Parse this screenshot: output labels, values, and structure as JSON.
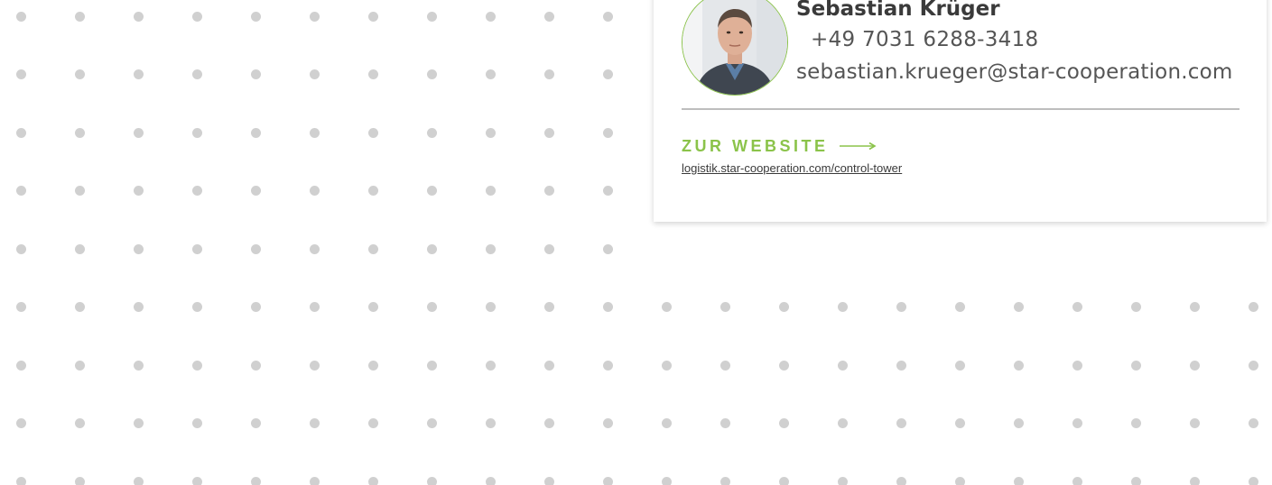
{
  "contact": {
    "name": "Sebastian Krüger",
    "phone": "+49 7031 6288-3418",
    "email": "sebastian.krueger@star-cooperation.com",
    "avatar_icon": "person-photo"
  },
  "website": {
    "cta_label": "ZUR WEBSITE",
    "cta_icon": "long-arrow-right-icon",
    "url_text": "logistik.star-cooperation.com/control-tower"
  },
  "colors": {
    "accent": "#8bc34a",
    "dot": "#d0d0d0",
    "text": "#555555",
    "divider": "#bdbdbd"
  }
}
